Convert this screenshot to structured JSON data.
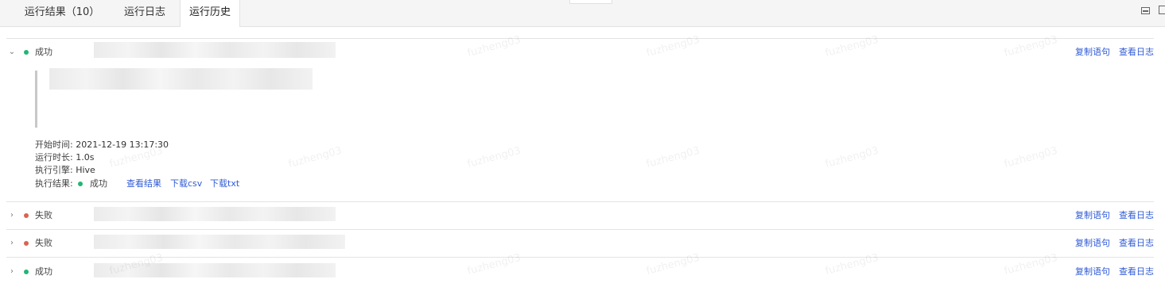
{
  "tabs": [
    {
      "label": "运行结果（10）"
    },
    {
      "label": "运行日志"
    },
    {
      "label": "运行历史"
    }
  ],
  "history": [
    {
      "status": "成功",
      "status_color": "#22b573",
      "expanded": true,
      "copy_label": "复制语句",
      "log_label": "查看日志"
    },
    {
      "status": "失败",
      "status_color": "#d9644f",
      "expanded": false,
      "copy_label": "复制语句",
      "log_label": "查看日志"
    },
    {
      "status": "失败",
      "status_color": "#d9644f",
      "expanded": false,
      "copy_label": "复制语句",
      "log_label": "查看日志"
    },
    {
      "status": "成功",
      "status_color": "#22b573",
      "expanded": false,
      "copy_label": "复制语句",
      "log_label": "查看日志"
    }
  ],
  "detail": {
    "start_time_label": "开始时间:",
    "start_time": "2021-12-19 13:17:30",
    "duration_label": "运行时长:",
    "duration": "1.0s",
    "engine_label": "执行引擎:",
    "engine": "Hive",
    "result_label": "执行结果:",
    "result_status": "成功",
    "view_result": "查看结果",
    "download_csv": "下载csv",
    "download_txt": "下载txt"
  },
  "watermark": "fuzheng03",
  "colors": {
    "link": "#2f5bd6",
    "success": "#22b573",
    "failure": "#d9644f"
  }
}
